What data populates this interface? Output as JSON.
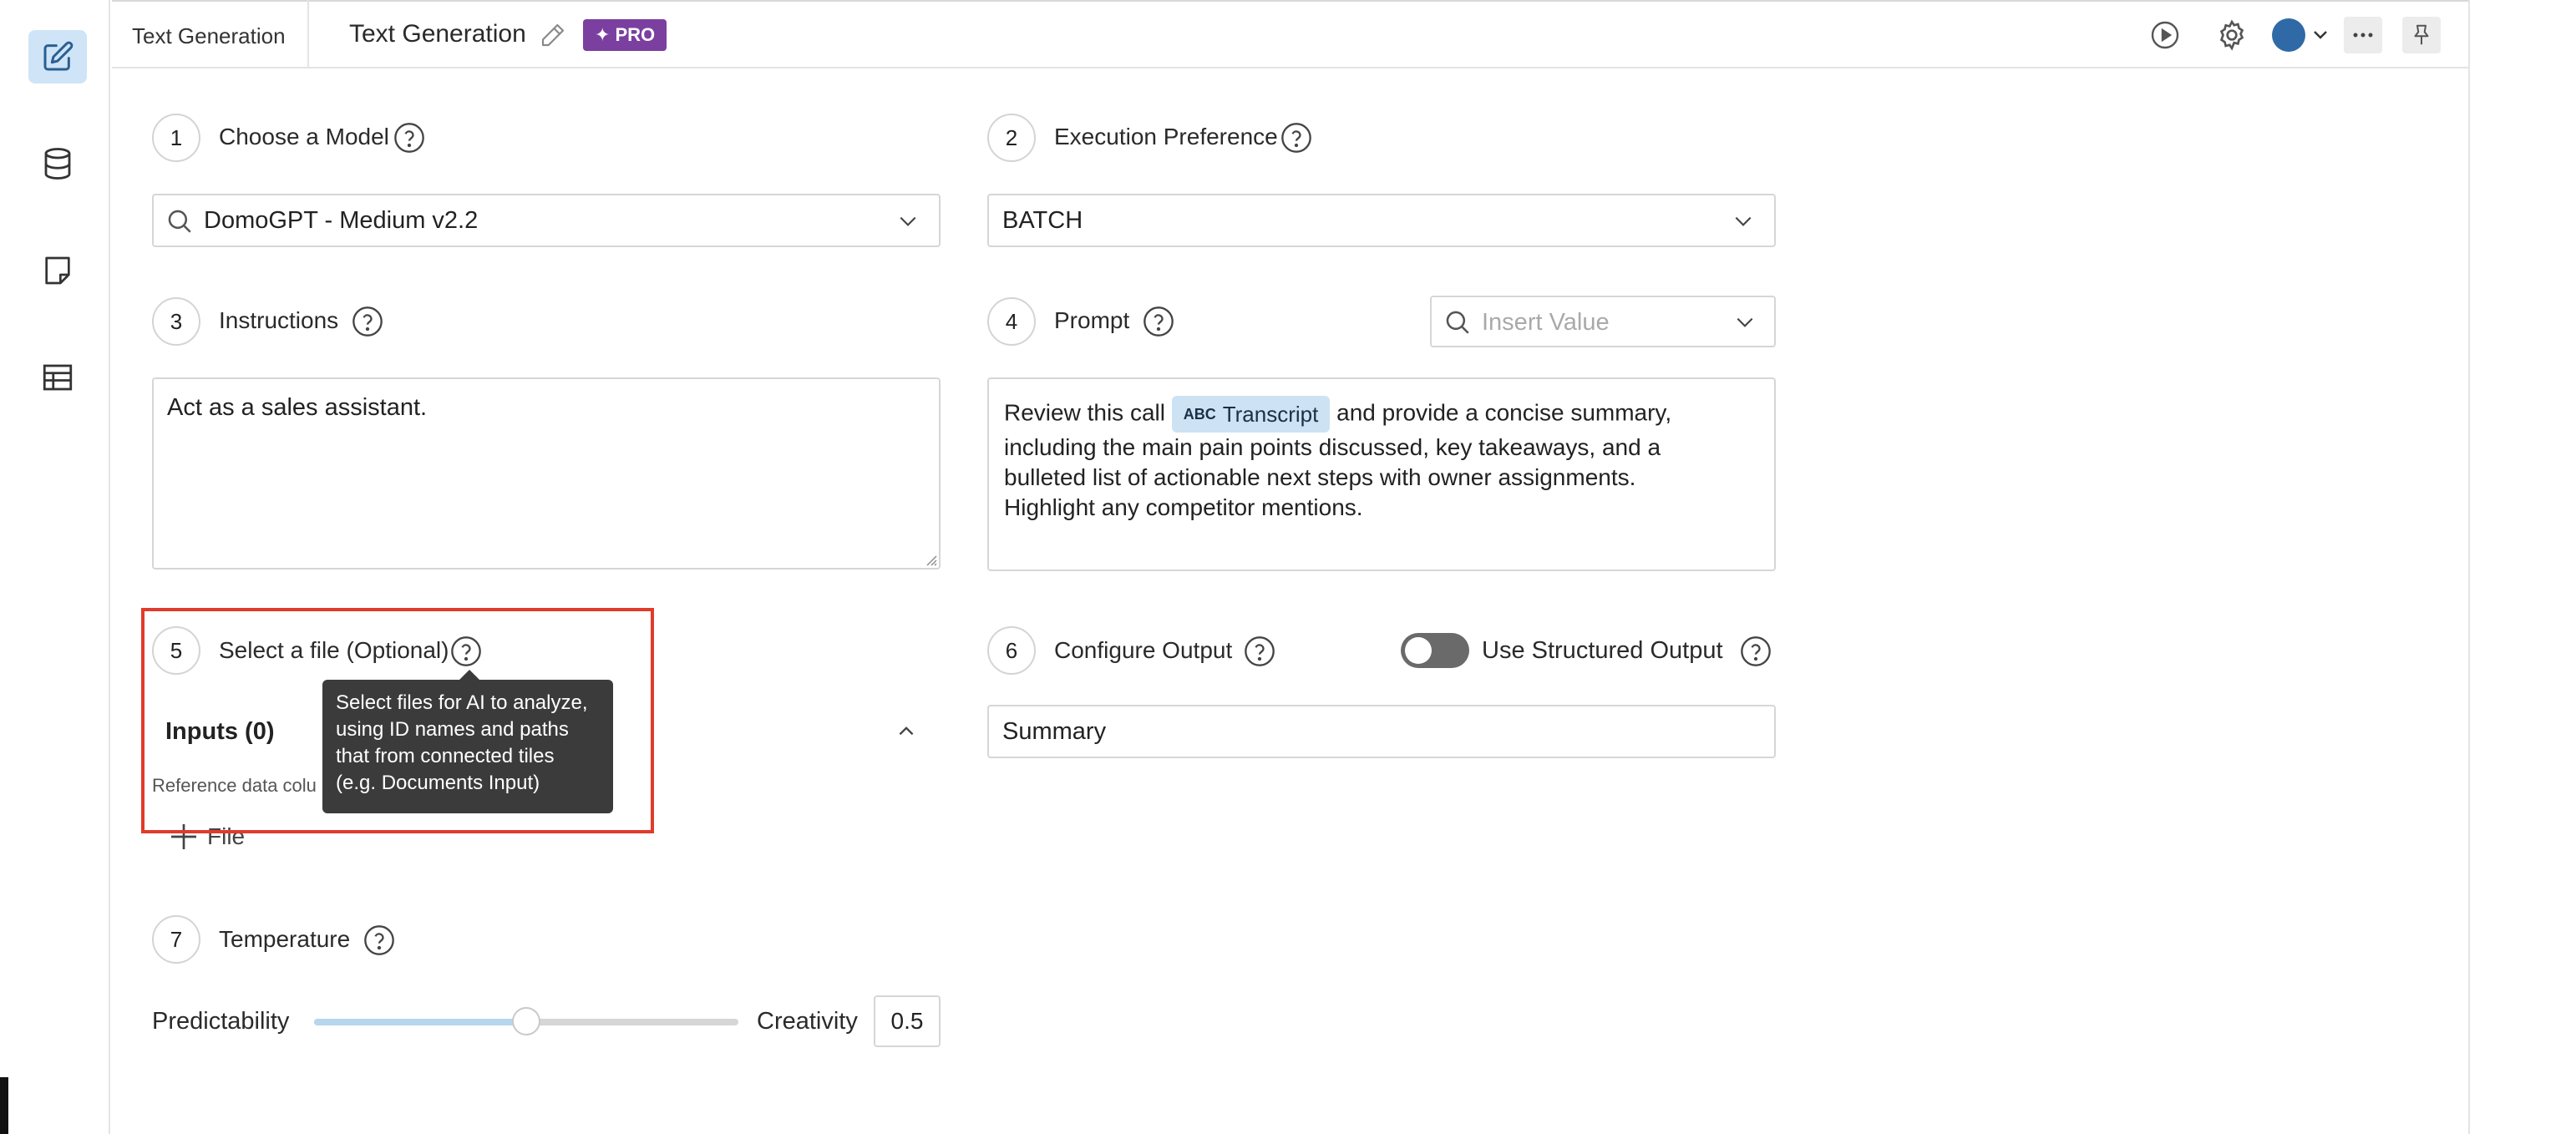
{
  "header": {
    "tab_label": "Text Generation",
    "title": "Text Generation",
    "badge": "PRO"
  },
  "sections": {
    "model": {
      "number": "1",
      "label": "Choose a Model",
      "value": "DomoGPT - Medium v2.2"
    },
    "execution": {
      "number": "2",
      "label": "Execution Preference",
      "value": "BATCH"
    },
    "instructions": {
      "number": "3",
      "label": "Instructions",
      "value": "Act as a sales assistant."
    },
    "prompt": {
      "number": "4",
      "label": "Prompt",
      "insert_placeholder": "Insert Value",
      "text_before": "Review this call",
      "chip_icon": "ABC",
      "chip_label": "Transcript",
      "text_after": "and provide a concise summary,",
      "line2": "including the main pain points discussed, key takeaways, and a",
      "line3": "bulleted list of actionable next steps with owner assignments.",
      "line4": "Highlight any competitor mentions."
    },
    "file": {
      "number": "5",
      "label": "Select a file (Optional)",
      "inputs_title": "Inputs (0)",
      "reference_text": "Reference data colu",
      "add_file_label": "File"
    },
    "output": {
      "number": "6",
      "label": "Configure Output",
      "structured_label": "Use Structured Output",
      "value": "Summary"
    },
    "temperature": {
      "number": "7",
      "label": "Temperature",
      "left_label": "Predictability",
      "right_label": "Creativity",
      "value": "0.5",
      "fraction": 0.5
    }
  },
  "tooltip": {
    "line1": "Select files for AI to analyze,",
    "line2": "using ID names and paths",
    "line3": "that from connected tiles",
    "line4": "(e.g. Documents Input)"
  },
  "colors": {
    "accent": "#cfe4f6",
    "pro_badge": "#7b3fa0",
    "highlight": "#e03b2b",
    "avatar": "#2f6aa6"
  },
  "icons": {
    "sidebar": [
      "edit-icon",
      "database-icon",
      "note-icon",
      "table-icon"
    ],
    "header": [
      "play-icon",
      "gear-icon",
      "avatar",
      "more-icon",
      "pin-icon"
    ]
  }
}
